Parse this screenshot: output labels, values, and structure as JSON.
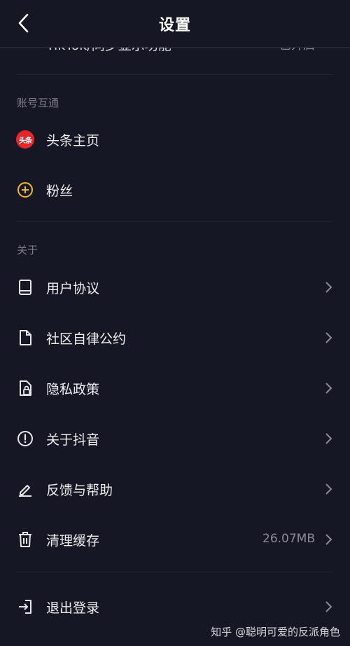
{
  "header": {
    "title": "设置"
  },
  "partial_row": {
    "label": "TikTok/同步显示功能",
    "value": "已开启"
  },
  "sections": {
    "account": {
      "title": "账号互通"
    },
    "about": {
      "title": "关于"
    }
  },
  "account_items": [
    {
      "label": "头条主页",
      "icon_text": "头条"
    },
    {
      "label": "粉丝"
    }
  ],
  "about_items": [
    {
      "label": "用户协议"
    },
    {
      "label": "社区自律公约"
    },
    {
      "label": "隐私政策"
    },
    {
      "label": "关于抖音"
    },
    {
      "label": "反馈与帮助"
    },
    {
      "label": "清理缓存",
      "value": "26.07MB"
    }
  ],
  "logout": {
    "label": "退出登录"
  },
  "watermark": "知乎 @聪明可爱的反派角色",
  "colors": {
    "background": "#161724",
    "toutiao_red": "#e6262a",
    "fans_yellow": "#f3b62a"
  }
}
